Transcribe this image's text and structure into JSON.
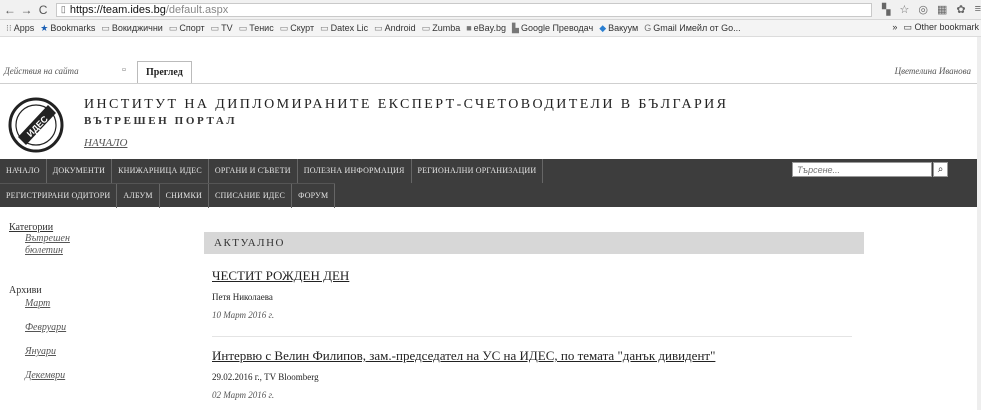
{
  "browser": {
    "url_host": "https://team.ides.bg",
    "url_path": "/default.aspx",
    "bookmarks": [
      "Apps",
      "Bookmarks",
      "Вокиджични",
      "Спорт",
      "TV",
      "Тенис",
      "Скурт",
      "Datex Lic",
      "Android",
      "Zumba",
      "eBay.bg",
      "Google Преводач",
      "Вакуум",
      "Gmail Имейл от Go..."
    ],
    "bookmarks_right": [
      "»",
      "Other bookmark"
    ]
  },
  "ribbon": {
    "site_actions": "Действия на сайта",
    "tab_view": "Преглед",
    "user": "Цветелина Иванова"
  },
  "header": {
    "title": "ИНСТИТУТ НА ДИПЛОМИРАНИТЕ ЕКСПЕРТ-СЧЕТОВОДИТЕЛИ В БЪЛГАРИЯ",
    "subtitle": "ВЪТРЕШЕН ПОРТАЛ",
    "home_link": "НАЧАЛО",
    "logo_text": "ИДЕС"
  },
  "nav": {
    "row1": [
      "НАЧАЛО",
      "ДОКУМЕНТИ",
      "КНИЖАРНИЦА ИДЕС",
      "ОРГАНИ И СЪВЕТИ",
      "ПОЛЕЗНА ИНФОРМАЦИЯ",
      "РЕГИОНАЛНИ ОРГАНИЗАЦИИ"
    ],
    "row2": [
      "РЕГИСТРИРАНИ ОДИТОРИ",
      "АЛБУМ",
      "СНИМКИ",
      "СПИСАНИЕ ИДЕС",
      "ФОРУМ"
    ],
    "search_placeholder": "Търсене..."
  },
  "sidebar": {
    "categories_label": "Категории",
    "category_items": [
      "Вътрешен",
      "бюлетин"
    ],
    "archive_label": "Архиви",
    "archive_items": [
      "Март",
      "Февруари",
      "Януари",
      "Декември"
    ]
  },
  "main": {
    "section_title": "АКТУАЛНО",
    "posts": [
      {
        "title": "ЧЕСТИТ РОЖДЕН ДЕН",
        "author": "Петя Николаева",
        "date": "10 Март 2016 г."
      },
      {
        "title": "Интервю с Велин Филипов, зам.-председател на УС на ИДЕС, по темата \"данък дивидент\"",
        "author": "29.02.2016 г., TV Bloomberg",
        "date": "02 Март 2016 г."
      }
    ]
  }
}
